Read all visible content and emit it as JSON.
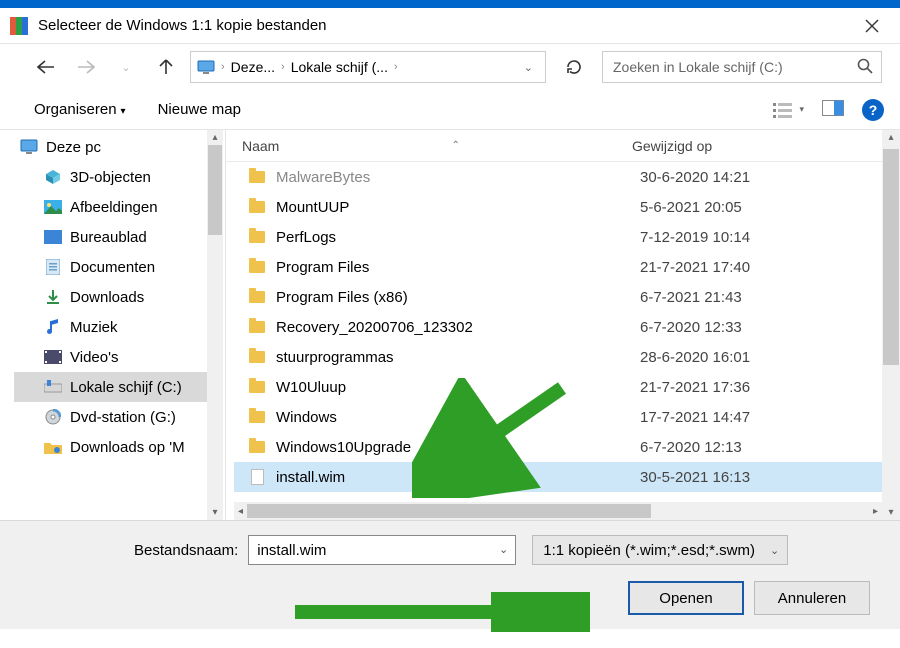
{
  "title": "Selecteer de Windows 1:1 kopie bestanden",
  "breadcrumb": {
    "root": "Deze...",
    "drive": "Lokale schijf (..."
  },
  "search": {
    "placeholder": "Zoeken in Lokale schijf (C:)"
  },
  "toolbar": {
    "organize": "Organiseren",
    "newfolder": "Nieuwe map"
  },
  "headers": {
    "name": "Naam",
    "modified": "Gewijzigd op"
  },
  "sidebar": {
    "root": "Deze pc",
    "items": [
      {
        "label": "3D-objecten",
        "icon": "cube"
      },
      {
        "label": "Afbeeldingen",
        "icon": "pictures"
      },
      {
        "label": "Bureaublad",
        "icon": "desktop"
      },
      {
        "label": "Documenten",
        "icon": "documents"
      },
      {
        "label": "Downloads",
        "icon": "downloads"
      },
      {
        "label": "Muziek",
        "icon": "music"
      },
      {
        "label": "Video's",
        "icon": "videos"
      },
      {
        "label": "Lokale schijf (C:)",
        "icon": "drive",
        "selected": true
      },
      {
        "label": "Dvd-station (G:)",
        "icon": "dvd"
      },
      {
        "label": "Downloads op 'M",
        "icon": "netfolder",
        "truncated": true
      }
    ]
  },
  "files": [
    {
      "name": "MalwareBytes",
      "date": "30-6-2020 14:21",
      "type": "folder",
      "cut": true
    },
    {
      "name": "MountUUP",
      "date": "5-6-2021 20:05",
      "type": "folder"
    },
    {
      "name": "PerfLogs",
      "date": "7-12-2019 10:14",
      "type": "folder"
    },
    {
      "name": "Program Files",
      "date": "21-7-2021 17:40",
      "type": "folder"
    },
    {
      "name": "Program Files (x86)",
      "date": "6-7-2021 21:43",
      "type": "folder"
    },
    {
      "name": "Recovery_20200706_123302",
      "date": "6-7-2020 12:33",
      "type": "folder"
    },
    {
      "name": "stuurprogrammas",
      "date": "28-6-2020 16:01",
      "type": "folder"
    },
    {
      "name": "W10Uluup",
      "date": "21-7-2021 17:36",
      "type": "folder"
    },
    {
      "name": "Windows",
      "date": "17-7-2021 14:47",
      "type": "folder"
    },
    {
      "name": "Windows10Upgrade",
      "date": "6-7-2020 12:13",
      "type": "folder"
    },
    {
      "name": "install.wim",
      "date": "30-5-2021 16:13",
      "type": "file",
      "selected": true
    }
  ],
  "footer": {
    "filename_label": "Bestandsnaam:",
    "filename_value": "install.wim",
    "filter": "1:1 kopieën (*.wim;*.esd;*.swm)",
    "open": "Openen",
    "cancel": "Annuleren"
  }
}
